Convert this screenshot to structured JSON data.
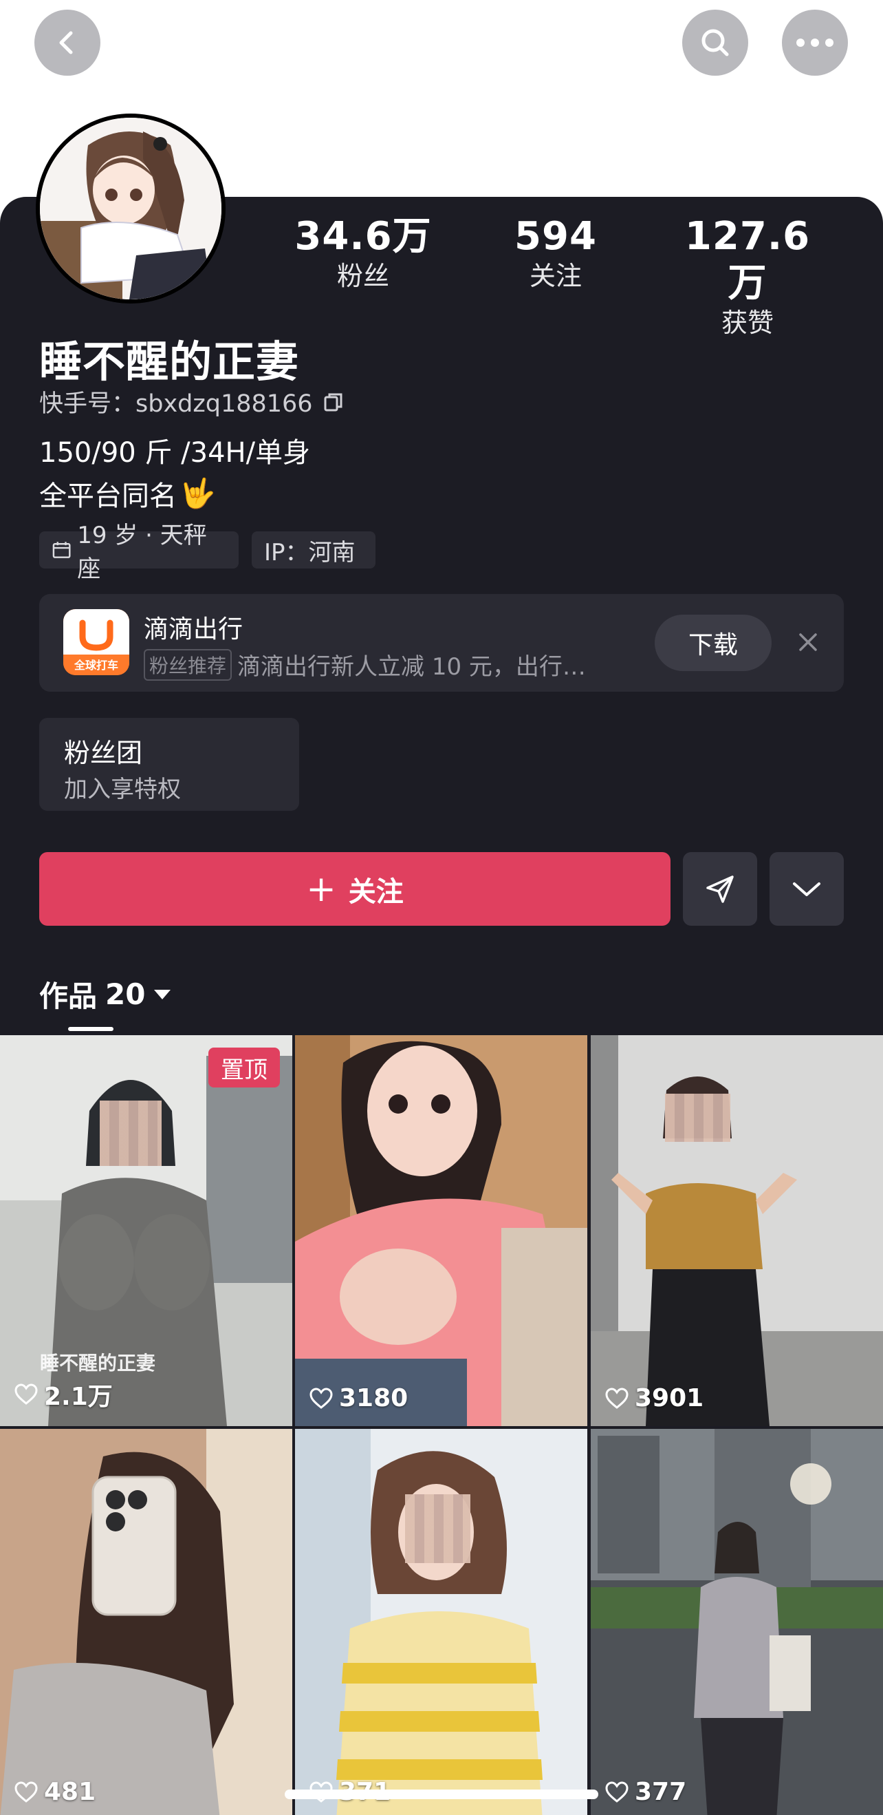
{
  "profile": {
    "name": "睡不醒的正妻",
    "kuaishou_id": "快手号：sbxdzq188166",
    "bio_line1": "150/90 斤 /34H/单身",
    "bio_line2": "全平台同名",
    "bio_emoji": "🤟",
    "tags": [
      {
        "label": "19 岁 · 天秤座",
        "icon": "calendar-icon"
      },
      {
        "label": "IP：河南"
      }
    ]
  },
  "stats": [
    {
      "value": "34.6万",
      "label": "粉丝"
    },
    {
      "value": "594",
      "label": "关注"
    },
    {
      "value": "127.6万",
      "label": "获赞"
    }
  ],
  "ad": {
    "title": "滴滴出行",
    "badge": "粉丝推荐",
    "text": "滴滴出行新人立减 10 元，出行…",
    "logo_text": "全球打车",
    "download_label": "下载",
    "logo_color": "#ff7a2b"
  },
  "fans_group": {
    "title": "粉丝团",
    "subtitle": "加入享特权"
  },
  "actions": {
    "follow_label": "关注",
    "follow_color": "#e0405f"
  },
  "tabs": {
    "works_label": "作品",
    "works_count": "20"
  },
  "grid": {
    "pin_label": "置顶",
    "watermark": "睡不醒的正妻",
    "items": [
      {
        "likes": "2.1万"
      },
      {
        "likes": "3180"
      },
      {
        "likes": "3901"
      },
      {
        "likes": "481"
      },
      {
        "likes": "371"
      },
      {
        "likes": "377"
      }
    ]
  }
}
